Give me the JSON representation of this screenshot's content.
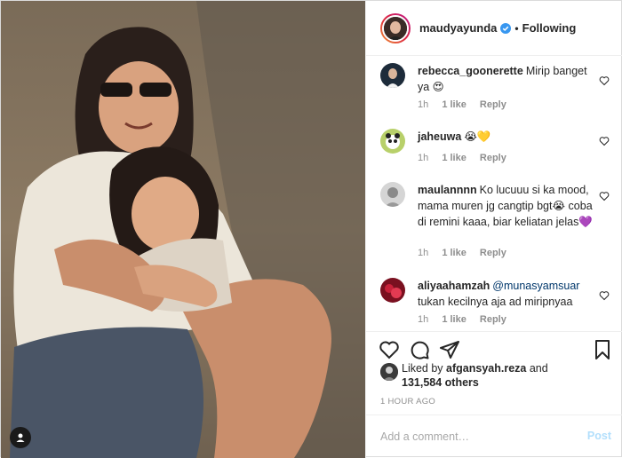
{
  "photo": {
    "description_icon": "user-tag-icon"
  },
  "header": {
    "username": "maudyayunda",
    "separator": "•",
    "follow_status": "Following"
  },
  "comments": [
    {
      "username": "rebecca_goonerette",
      "text": "Mirip banget ya 😍",
      "time": "1h",
      "likes": "1 like",
      "reply": "Reply"
    },
    {
      "username": "jaheuwa",
      "text": "😭💛",
      "time": "1h",
      "likes": "1 like",
      "reply": "Reply"
    },
    {
      "username": "maulannnn",
      "text": "Ko lucuuu si ka mood, mama muren jg cangtip bgt😭 coba di remini kaaa, biar keliatan jelas💜",
      "time": "1h",
      "likes": "1 like",
      "reply": "Reply"
    },
    {
      "username": "aliyaahamzah",
      "mention": "@munasyamsuar",
      "text": "tukan kecilnya aja ad miripnyaa",
      "time": "1h",
      "likes": "1 like",
      "reply": "Reply"
    }
  ],
  "likes": {
    "prefix": "Liked by",
    "user": "afgansyah.reza",
    "and": "and",
    "others": "131,584 others"
  },
  "time_ago": "1 HOUR AGO",
  "add_comment": {
    "placeholder": "Add a comment…",
    "post_label": "Post"
  },
  "colors": {
    "accent": "#0095f6",
    "post_disabled": "#b2dffc",
    "muted": "#8e8e8e",
    "verified": "#3897f0"
  }
}
